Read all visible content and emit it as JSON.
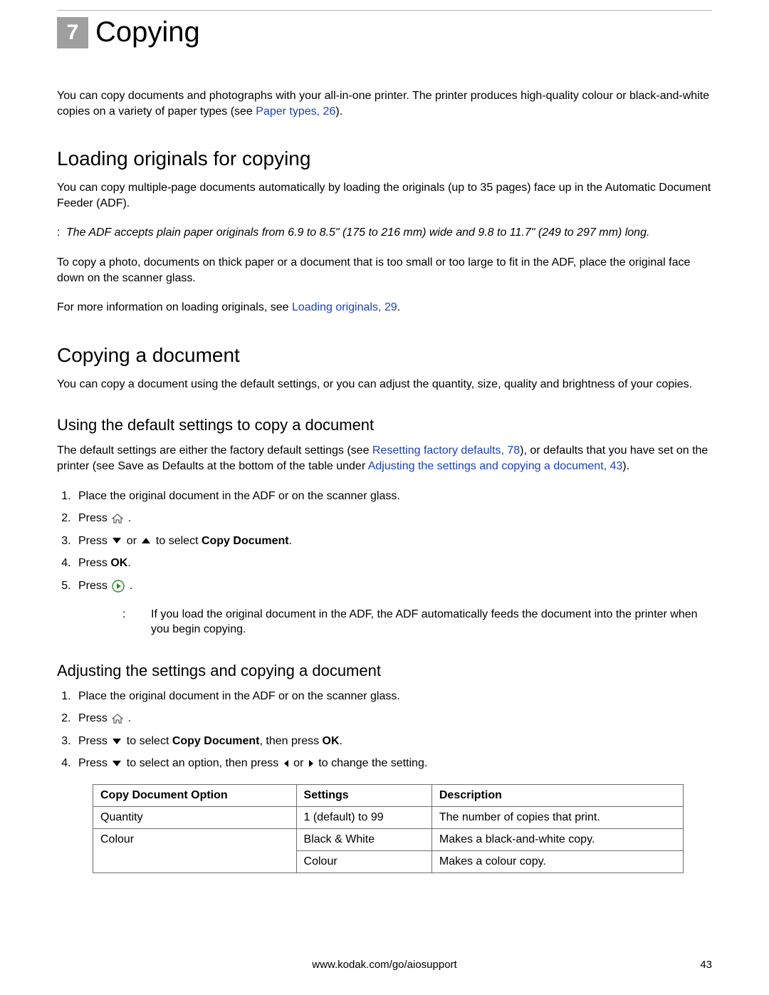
{
  "chapter": {
    "number": "7",
    "title": "Copying"
  },
  "intro": {
    "t1": "You can copy documents and photographs with your all-in-one printer. The printer produces high-quality colour or black-and-white copies on a variety of paper types (see ",
    "link1": "Paper types, 26",
    "t2": ")."
  },
  "sec1": {
    "h": "Loading originals for copying",
    "p1": "You can copy multiple-page documents automatically by loading the originals (up to 35 pages) face up in the Automatic Document Feeder (ADF).",
    "note_colon": ":",
    "note": "The ADF accepts plain paper originals from 6.9 to 8.5\" (175 to 216 mm) wide and 9.8 to 11.7\" (249 to 297 mm) long.",
    "p2": "To copy a photo, documents on thick paper or a document that is too small or too large to fit in the ADF, place the original face down on the scanner glass.",
    "p3a": "For more information on loading originals, see ",
    "link": "Loading originals, 29",
    "p3b": "."
  },
  "sec2": {
    "h": "Copying a document",
    "p": "You can copy a document using the default settings, or you can adjust the quantity, size, quality and brightness of your copies."
  },
  "sec3": {
    "h": "Using the default settings to copy a document",
    "p_a": "The default settings are either the factory default settings (see ",
    "link1": "Resetting factory defaults, 78",
    "p_b": "), or defaults that you have set on the printer (see Save as Defaults at the bottom of the table under ",
    "link2": "Adjusting the settings and copying a document, 43",
    "p_c": ").",
    "steps": {
      "s1": "Place the original document in the ADF or on the scanner glass.",
      "s2a": "Press ",
      "s2b": ".",
      "s3a": "Press ",
      "s3b": " or ",
      "s3c": " to select ",
      "s3bold": "Copy Document",
      "s3d": ".",
      "s4a": "Press ",
      "s4bold": "OK",
      "s4b": ".",
      "s5a": "Press ",
      "s5b": "."
    },
    "note_colon": ":",
    "note": "If you load the original document in the ADF, the ADF automatically feeds the document into the printer when you begin copying."
  },
  "sec4": {
    "h": "Adjusting the settings and copying a document",
    "steps": {
      "s1": "Place the original document in the ADF or on the scanner glass.",
      "s2a": "Press ",
      "s2b": ".",
      "s3a": "Press ",
      "s3b": " to select ",
      "s3bold1": "Copy Document",
      "s3c": ", then press ",
      "s3bold2": "OK",
      "s3d": ".",
      "s4a": "Press ",
      "s4b": " to select an option, then press ",
      "s4c": " or ",
      "s4d": " to change the setting."
    },
    "table": {
      "h1": "Copy Document Option",
      "h2": "Settings",
      "h3": "Description",
      "rows": [
        {
          "c1": "Quantity",
          "c2": "1 (default) to 99",
          "c3": "The number of copies that print."
        },
        {
          "c1": "Colour",
          "c2": "Black & White",
          "c3": "Makes a black-and-white copy."
        },
        {
          "c1": "",
          "c2": "Colour",
          "c3": "Makes a colour copy."
        }
      ]
    }
  },
  "footer": {
    "url": "www.kodak.com/go/aiosupport",
    "page": "43"
  }
}
